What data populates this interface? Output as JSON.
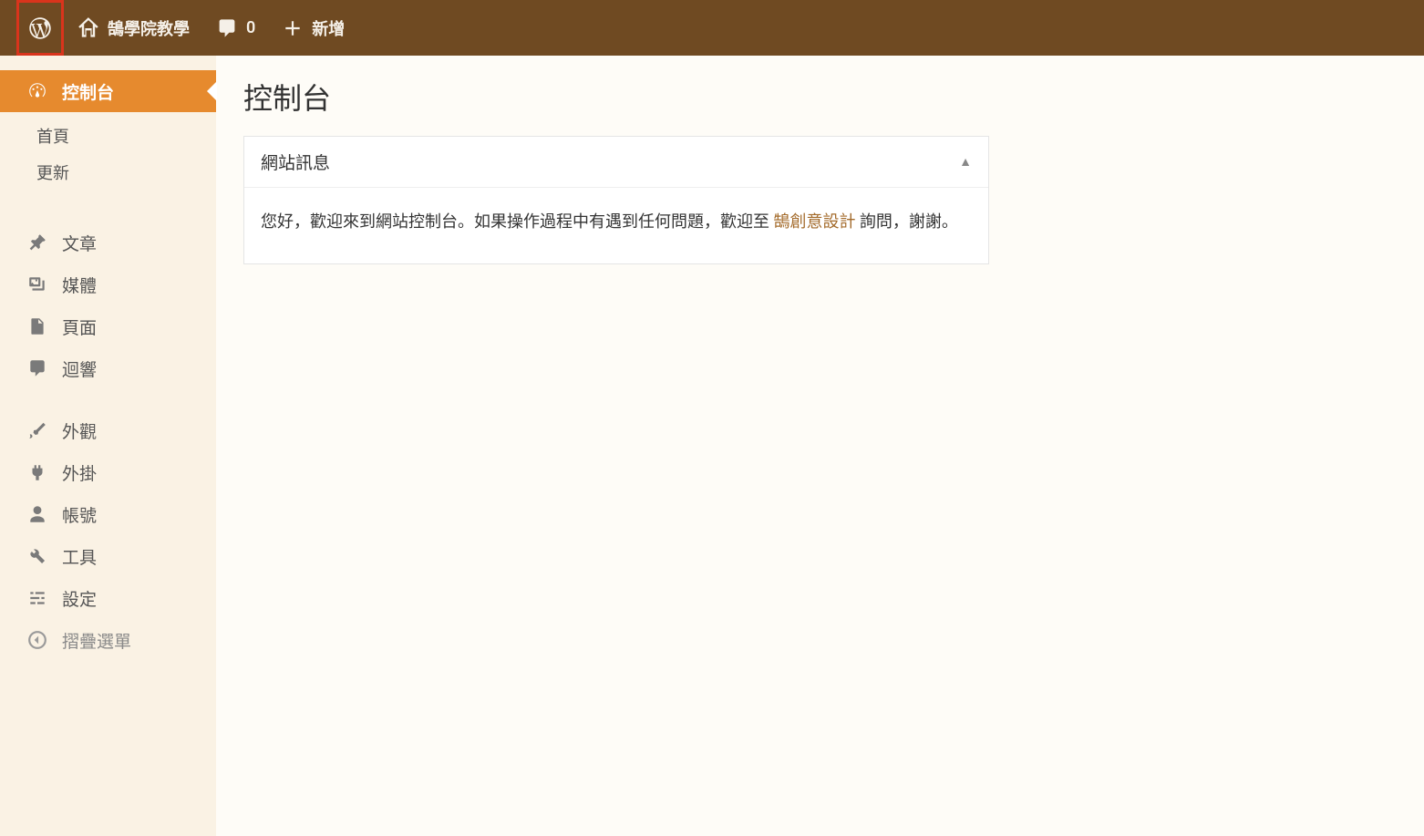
{
  "adminbar": {
    "site_name": "鵠學院教學",
    "comment_count": "0",
    "new_label": "新增"
  },
  "sidebar": {
    "dashboard": "控制台",
    "submenu": {
      "home": "首頁",
      "updates": "更新"
    },
    "posts": "文章",
    "media": "媒體",
    "pages": "頁面",
    "comments": "迴響",
    "appearance": "外觀",
    "plugins": "外掛",
    "users": "帳號",
    "tools": "工具",
    "settings": "設定",
    "collapse": "摺疊選單"
  },
  "content": {
    "page_title": "控制台",
    "panel_title": "網站訊息",
    "welcome_text_before": "您好，歡迎來到網站控制台。如果操作過程中有遇到任何問題，歡迎至 ",
    "welcome_link": "鵠創意設計",
    "welcome_text_after": " 詢問，謝謝。"
  },
  "highlight": {
    "element": "wp-logo",
    "color": "#d9341c"
  }
}
